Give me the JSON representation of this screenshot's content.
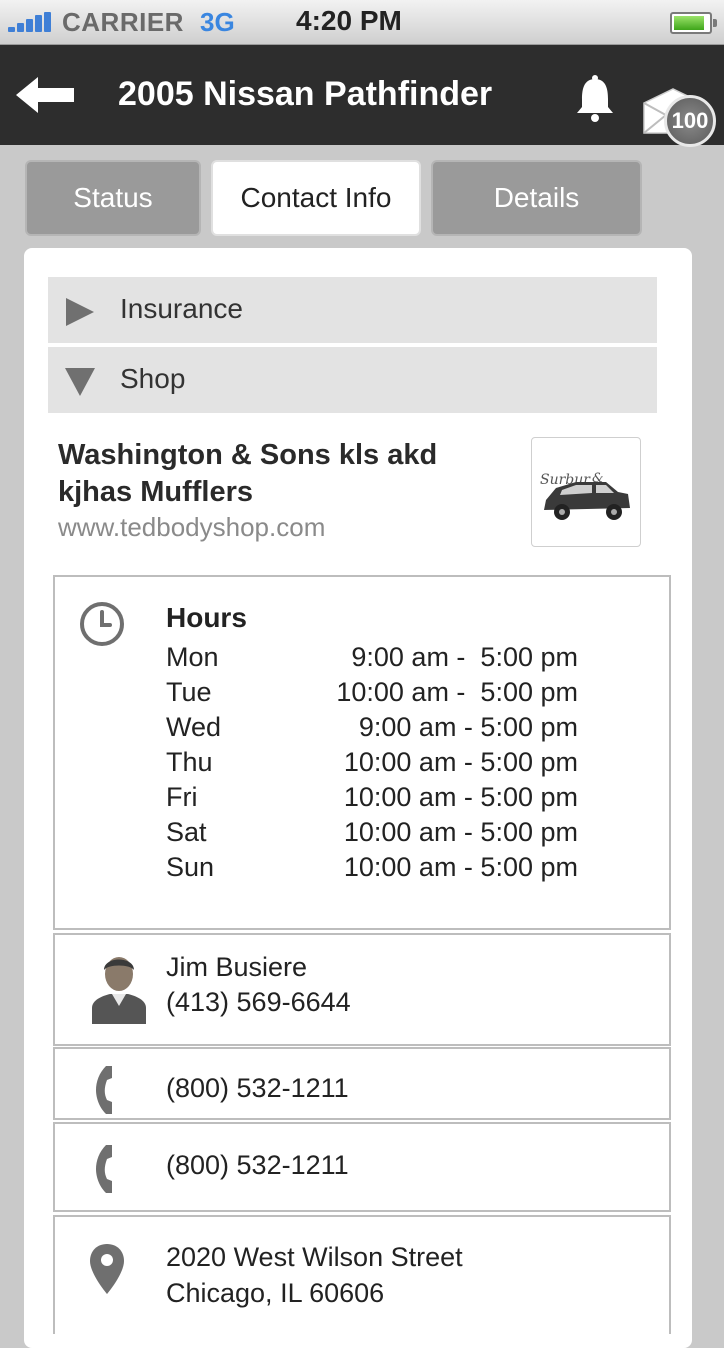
{
  "status_bar": {
    "carrier": "CARRIER",
    "network": "3G",
    "time": "4:20 PM",
    "signal_icon": "signal-bars-icon",
    "battery_icon": "battery-icon"
  },
  "nav": {
    "title": "2005 Nissan Pathfinder",
    "back_icon": "back-arrow-icon",
    "bell_icon": "bell-icon",
    "mail_icon": "mail-icon",
    "mail_badge": "100"
  },
  "tabs": [
    {
      "label": "Status",
      "active": false
    },
    {
      "label": "Contact Info",
      "active": true
    },
    {
      "label": "Details",
      "active": false
    }
  ],
  "sections": [
    {
      "label": "Insurance",
      "expanded": false
    },
    {
      "label": "Shop",
      "expanded": true
    }
  ],
  "shop": {
    "name_line1": "Washington & Sons kls akd",
    "name_line2": "kjhas Mufflers",
    "url": "www.tedbodyshop.com",
    "logo_icon": "car-logo-icon"
  },
  "hours": {
    "title": "Hours",
    "icon": "clock-icon",
    "rows": [
      {
        "day": "Mon",
        "time": "9:00 am -  5:00 pm"
      },
      {
        "day": "Tue",
        "time": "10:00 am -  5:00 pm"
      },
      {
        "day": "Wed",
        "time": "9:00 am - 5:00 pm"
      },
      {
        "day": "Thu",
        "time": "10:00 am - 5:00 pm"
      },
      {
        "day": "Fri",
        "time": "10:00 am - 5:00 pm"
      },
      {
        "day": "Sat",
        "time": "10:00 am - 5:00 pm"
      },
      {
        "day": "Sun",
        "time": "10:00 am - 5:00 pm"
      }
    ]
  },
  "contact": {
    "name": "Jim Busiere",
    "phone": "(413) 569-6644",
    "icon": "person-icon"
  },
  "phones": [
    {
      "number": "(800) 532-1211",
      "icon": "phone-icon"
    },
    {
      "number": "(800) 532-1211",
      "icon": "phone-icon"
    }
  ],
  "address": {
    "line1": "2020 West Wilson Street",
    "line2": "Chicago, IL 60606",
    "icon": "map-pin-icon"
  },
  "colors": {
    "nav_bg": "#2d2d2d",
    "tab_inactive": "#9a9a9a",
    "accordion_bg": "#e3e3e3",
    "network_blue": "#3a86e0"
  }
}
